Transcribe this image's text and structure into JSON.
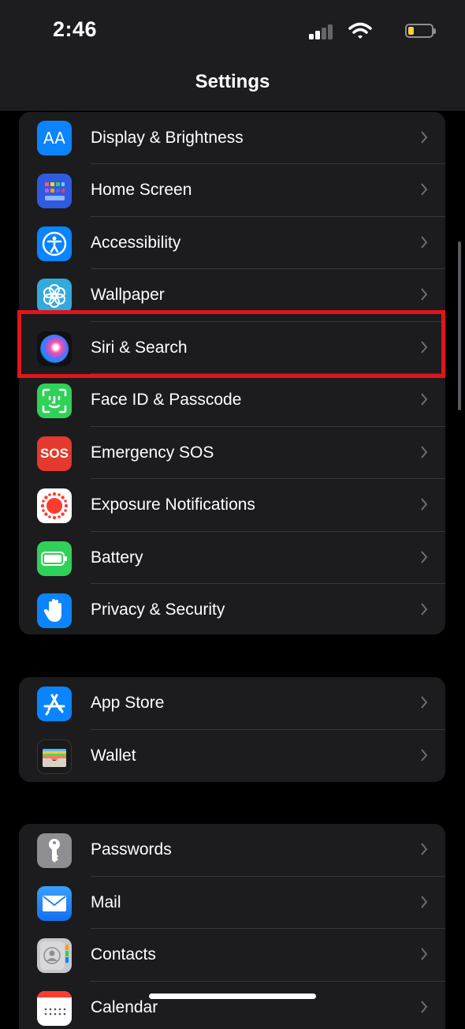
{
  "status_bar": {
    "time": "2:46",
    "signal_icon": "cellular-signal-icon",
    "wifi_icon": "wifi-icon",
    "battery_icon": "battery-icon",
    "battery_level_fraction": 0.25,
    "battery_color": "#f5d33b"
  },
  "nav": {
    "title": "Settings"
  },
  "groups": [
    {
      "items": [
        {
          "label": "Display & Brightness",
          "icon": "display-brightness-icon",
          "color": "#0a84ff"
        },
        {
          "label": "Home Screen",
          "icon": "home-screen-icon",
          "color": "#2f5be0"
        },
        {
          "label": "Accessibility",
          "icon": "accessibility-icon",
          "color": "#0a84ff"
        },
        {
          "label": "Wallpaper",
          "icon": "wallpaper-icon",
          "color": "#34aadc"
        },
        {
          "label": "Siri & Search",
          "icon": "siri-icon",
          "color": "#1c1c1e",
          "highlighted": true
        },
        {
          "label": "Face ID & Passcode",
          "icon": "face-id-icon",
          "color": "#30d158"
        },
        {
          "label": "Emergency SOS",
          "icon": "sos-icon",
          "color": "#e5392e",
          "icon_text": "SOS"
        },
        {
          "label": "Exposure Notifications",
          "icon": "exposure-notifications-icon",
          "color": "#ffffff"
        },
        {
          "label": "Battery",
          "icon": "battery-settings-icon",
          "color": "#30d158"
        },
        {
          "label": "Privacy & Security",
          "icon": "privacy-hand-icon",
          "color": "#0a84ff"
        }
      ]
    },
    {
      "items": [
        {
          "label": "App Store",
          "icon": "app-store-icon",
          "color": "#0a84ff"
        },
        {
          "label": "Wallet",
          "icon": "wallet-icon",
          "color": "#1a1a1a"
        }
      ]
    },
    {
      "items": [
        {
          "label": "Passwords",
          "icon": "key-icon",
          "color": "#8e8e93"
        },
        {
          "label": "Mail",
          "icon": "mail-icon",
          "color": "#0a84ff"
        },
        {
          "label": "Contacts",
          "icon": "contacts-icon",
          "color": "#c7c7cc"
        },
        {
          "label": "Calendar",
          "icon": "calendar-icon",
          "color": "#ffffff"
        }
      ]
    }
  ],
  "highlight_color": "#e3141b"
}
